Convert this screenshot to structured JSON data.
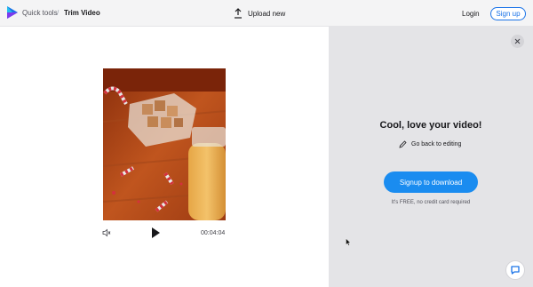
{
  "header": {
    "breadcrumb_link": "Quick tools",
    "breadcrumb_separator": "/",
    "breadcrumb_current": "Trim Video",
    "upload_label": "Upload new",
    "login_label": "Login",
    "signup_label": "Sign up"
  },
  "player": {
    "time": "00:04:04",
    "icons": [
      "volume-icon",
      "play-icon"
    ]
  },
  "panel": {
    "title": "Cool, love your video!",
    "back_label": "Go back to editing",
    "signup_button": "Signup to download",
    "note": "It's FREE, no credit card required"
  },
  "colors": {
    "accent": "#1a8cf0",
    "header_bg": "#f4f4f5",
    "panel_bg": "#e4e4e7"
  }
}
